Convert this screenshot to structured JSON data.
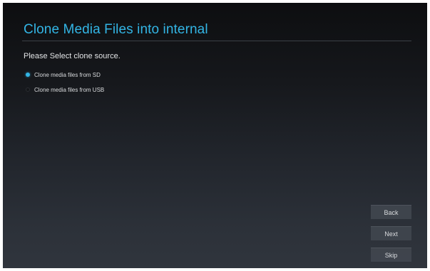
{
  "header": {
    "title": "Clone Media Files into internal"
  },
  "main": {
    "prompt": "Please Select clone source.",
    "options": [
      {
        "label": "Clone media files from SD",
        "selected": true
      },
      {
        "label": "Clone media files from USB",
        "selected": false
      }
    ]
  },
  "buttons": {
    "back": "Back",
    "next": "Next",
    "skip": "Skip"
  },
  "colors": {
    "accent": "#33b5e5"
  }
}
